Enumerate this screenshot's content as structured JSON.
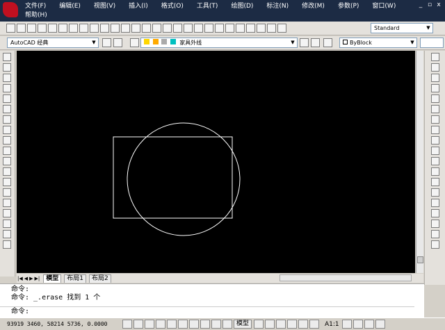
{
  "menu": {
    "items": [
      "文件(F)",
      "编辑(E)",
      "视图(V)",
      "插入(I)",
      "格式(O)",
      "工具(T)",
      "绘图(D)",
      "标注(N)",
      "修改(M)",
      "参数(P)",
      "窗口(W)",
      "帮助(H)"
    ]
  },
  "window_controls": {
    "min": "_",
    "restore": "▫",
    "close": "x"
  },
  "toolbar": {
    "textstyle_value": "Standard"
  },
  "layers": {
    "workspace": "AutoCAD 经典",
    "current_layer": "家具外线",
    "color": "ByBlock"
  },
  "layout_tabs": {
    "model": "模型",
    "layout1": "布局1",
    "layout2": "布局2"
  },
  "command": {
    "history": [
      "命令:",
      "命令: _.erase 找到 1 个"
    ],
    "prompt": "命令:"
  },
  "status": {
    "coords": "93919 3460, 58214 5736, 0.0000",
    "model_label": "模型",
    "scale": "A1:1",
    "layer_color": "#00c0c0"
  },
  "drawing": {
    "stroke_color": "#ffffff",
    "background": "#000000"
  }
}
